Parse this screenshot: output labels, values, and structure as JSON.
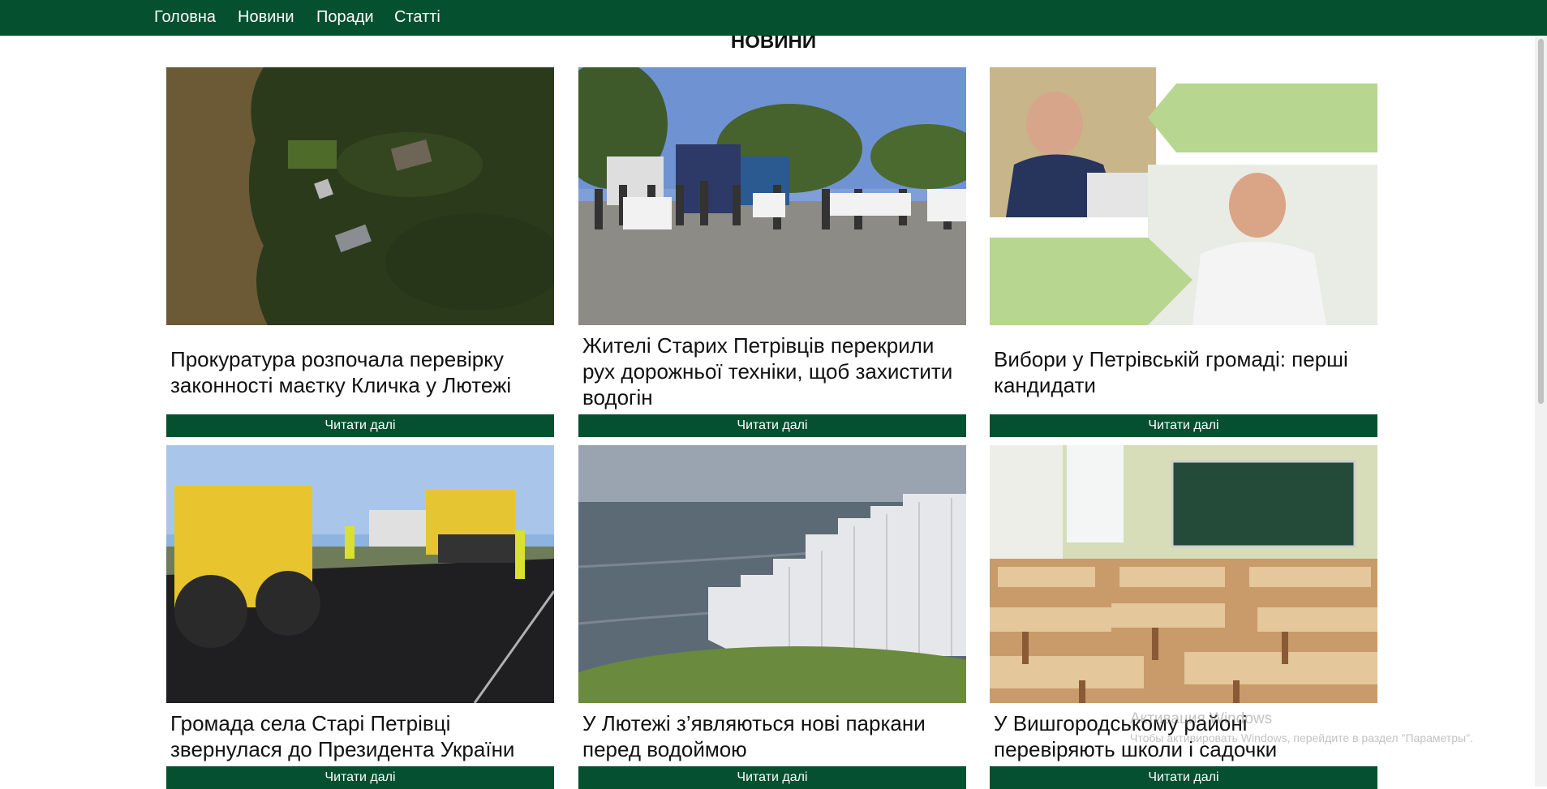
{
  "nav": {
    "items": [
      {
        "label": "Головна"
      },
      {
        "label": "Новини"
      },
      {
        "label": "Поради"
      },
      {
        "label": "Статті"
      }
    ]
  },
  "section": {
    "title": "Новини"
  },
  "cards": [
    {
      "title": "Прокуратура розпочала перевірку законності маєтку Кличка у Лютежі",
      "read_more": "Читати далі"
    },
    {
      "title": "Жителі Старих Петрівців перекрили рух дорожньої техніки, щоб захистити водогін",
      "read_more": "Читати далі"
    },
    {
      "title": "Вибори у Петрівській громаді: перші кандидати",
      "read_more": "Читати далі"
    },
    {
      "title": "Громада села Старі Петрівці звернулася до Президента України",
      "read_more": "Читати далі"
    },
    {
      "title": "У Лютежі з’являються нові паркани перед водоймою",
      "read_more": "Читати далі"
    },
    {
      "title": "У Вишгородському районі перевіряють школи і садочки",
      "read_more": "Читати далі"
    }
  ],
  "watermark": {
    "title": "Активация Windows",
    "text": "Чтобы активировать Windows, перейдите в раздел \"Параметры\"."
  },
  "colors": {
    "brand": "#04502f",
    "background": "#ffffff"
  }
}
